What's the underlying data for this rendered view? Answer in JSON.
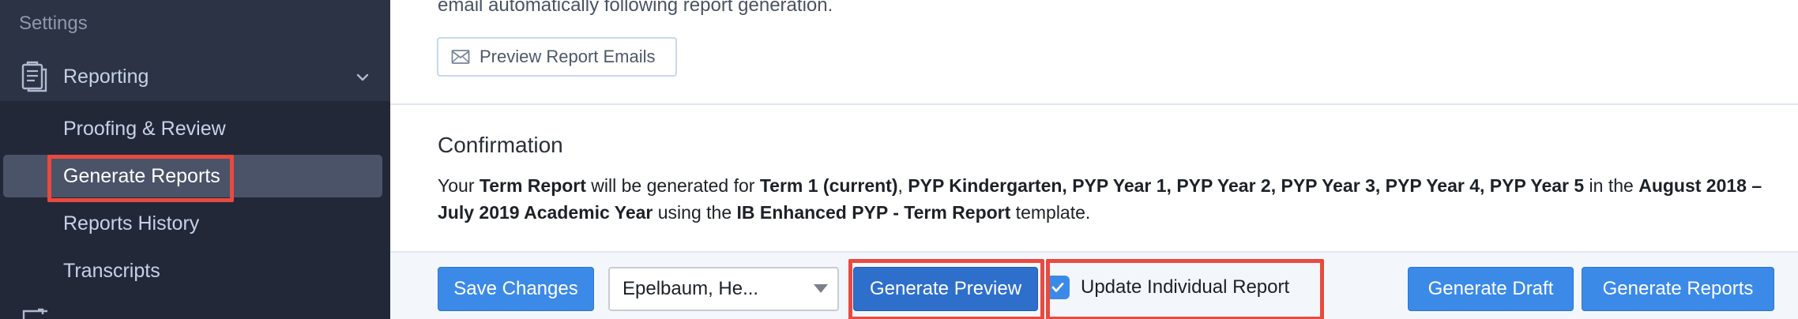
{
  "sidebar": {
    "settings_label": "Settings",
    "reporting_label": "Reporting",
    "items": [
      {
        "label": "Proofing & Review"
      },
      {
        "label": "Generate Reports"
      },
      {
        "label": "Reports History"
      },
      {
        "label": "Transcripts"
      }
    ]
  },
  "main": {
    "top_text": "email automatically following report generation.",
    "preview_emails_label": "Preview Report Emails",
    "confirmation": {
      "title": "Confirmation",
      "t1": "Your ",
      "b1": "Term Report",
      "t2": " will be generated for ",
      "b2": "Term 1 (current)",
      "t3": ", ",
      "b3": "PYP Kindergarten, PYP Year 1, PYP Year 2, PYP Year 3, PYP Year 4, PYP Year 5",
      "t4": " in the ",
      "b4": "August 2018 – July 2019 Academic Year",
      "t5": " using the ",
      "b5": "IB Enhanced PYP - Term Report",
      "t6": " template."
    }
  },
  "footer": {
    "save_label": "Save Changes",
    "student_select_value": "Epelbaum, He...",
    "generate_preview_label": "Generate Preview",
    "update_individual_label": "Update Individual Report",
    "update_individual_checked": true,
    "generate_draft_label": "Generate Draft",
    "generate_reports_label": "Generate Reports"
  },
  "colors": {
    "sidebar_bg": "#2c3345",
    "primary": "#3c8ae8",
    "highlight": "#e84a40"
  }
}
